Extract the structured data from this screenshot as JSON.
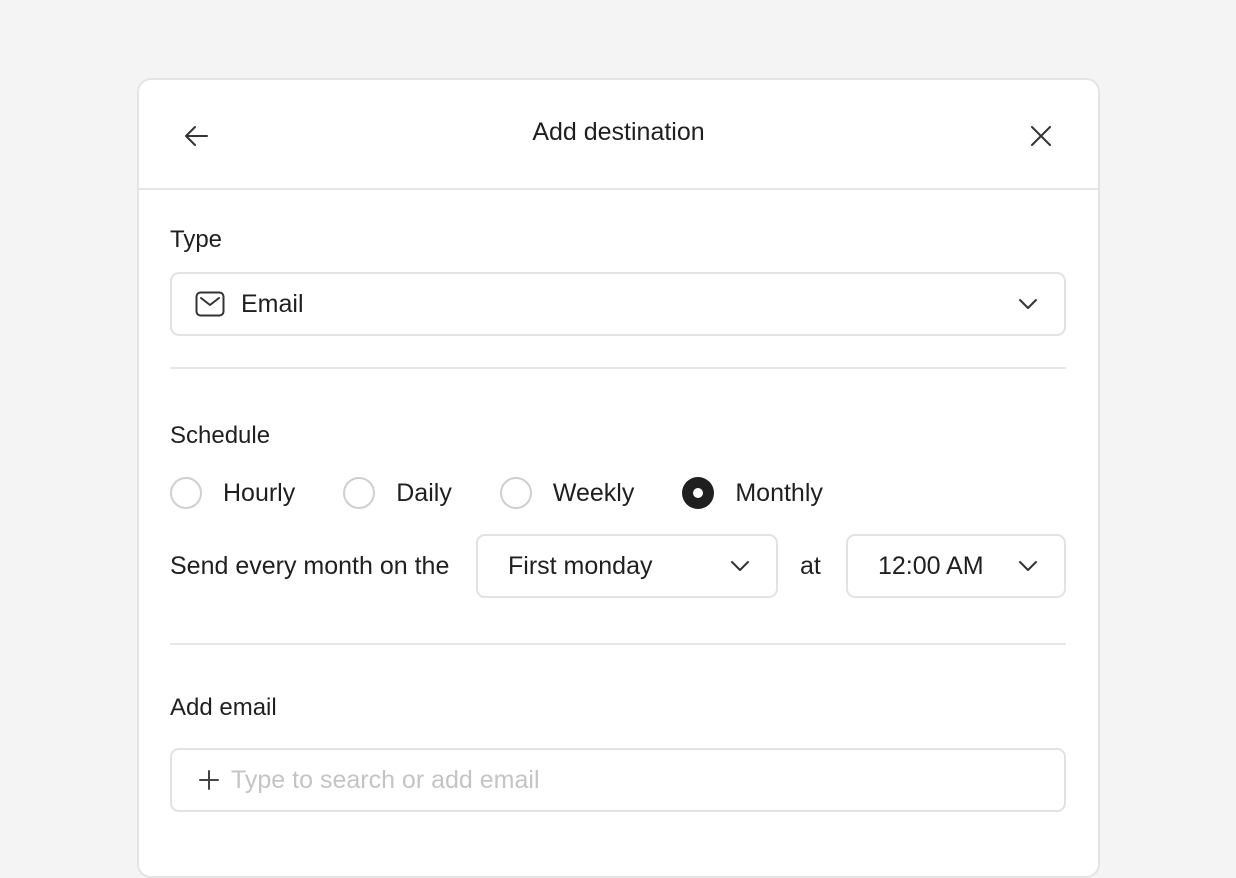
{
  "modal": {
    "title": "Add destination"
  },
  "type_section": {
    "label": "Type",
    "selected_value": "Email",
    "selected_icon": "mail-icon"
  },
  "schedule_section": {
    "label": "Schedule",
    "options": [
      {
        "label": "Hourly",
        "checked": false
      },
      {
        "label": "Daily",
        "checked": false
      },
      {
        "label": "Weekly",
        "checked": false
      },
      {
        "label": "Monthly",
        "checked": true
      }
    ],
    "send_prefix": "Send every month on the",
    "day_value": "First monday",
    "at_label": "at",
    "time_value": "12:00 AM"
  },
  "email_section": {
    "label": "Add email",
    "input_value": "",
    "placeholder": "Type to search or add email"
  },
  "colors": {
    "background": "#f4f4f4",
    "text": "#1f1f1f",
    "border": "#e2e2e2",
    "placeholder": "#c4c4c4"
  }
}
